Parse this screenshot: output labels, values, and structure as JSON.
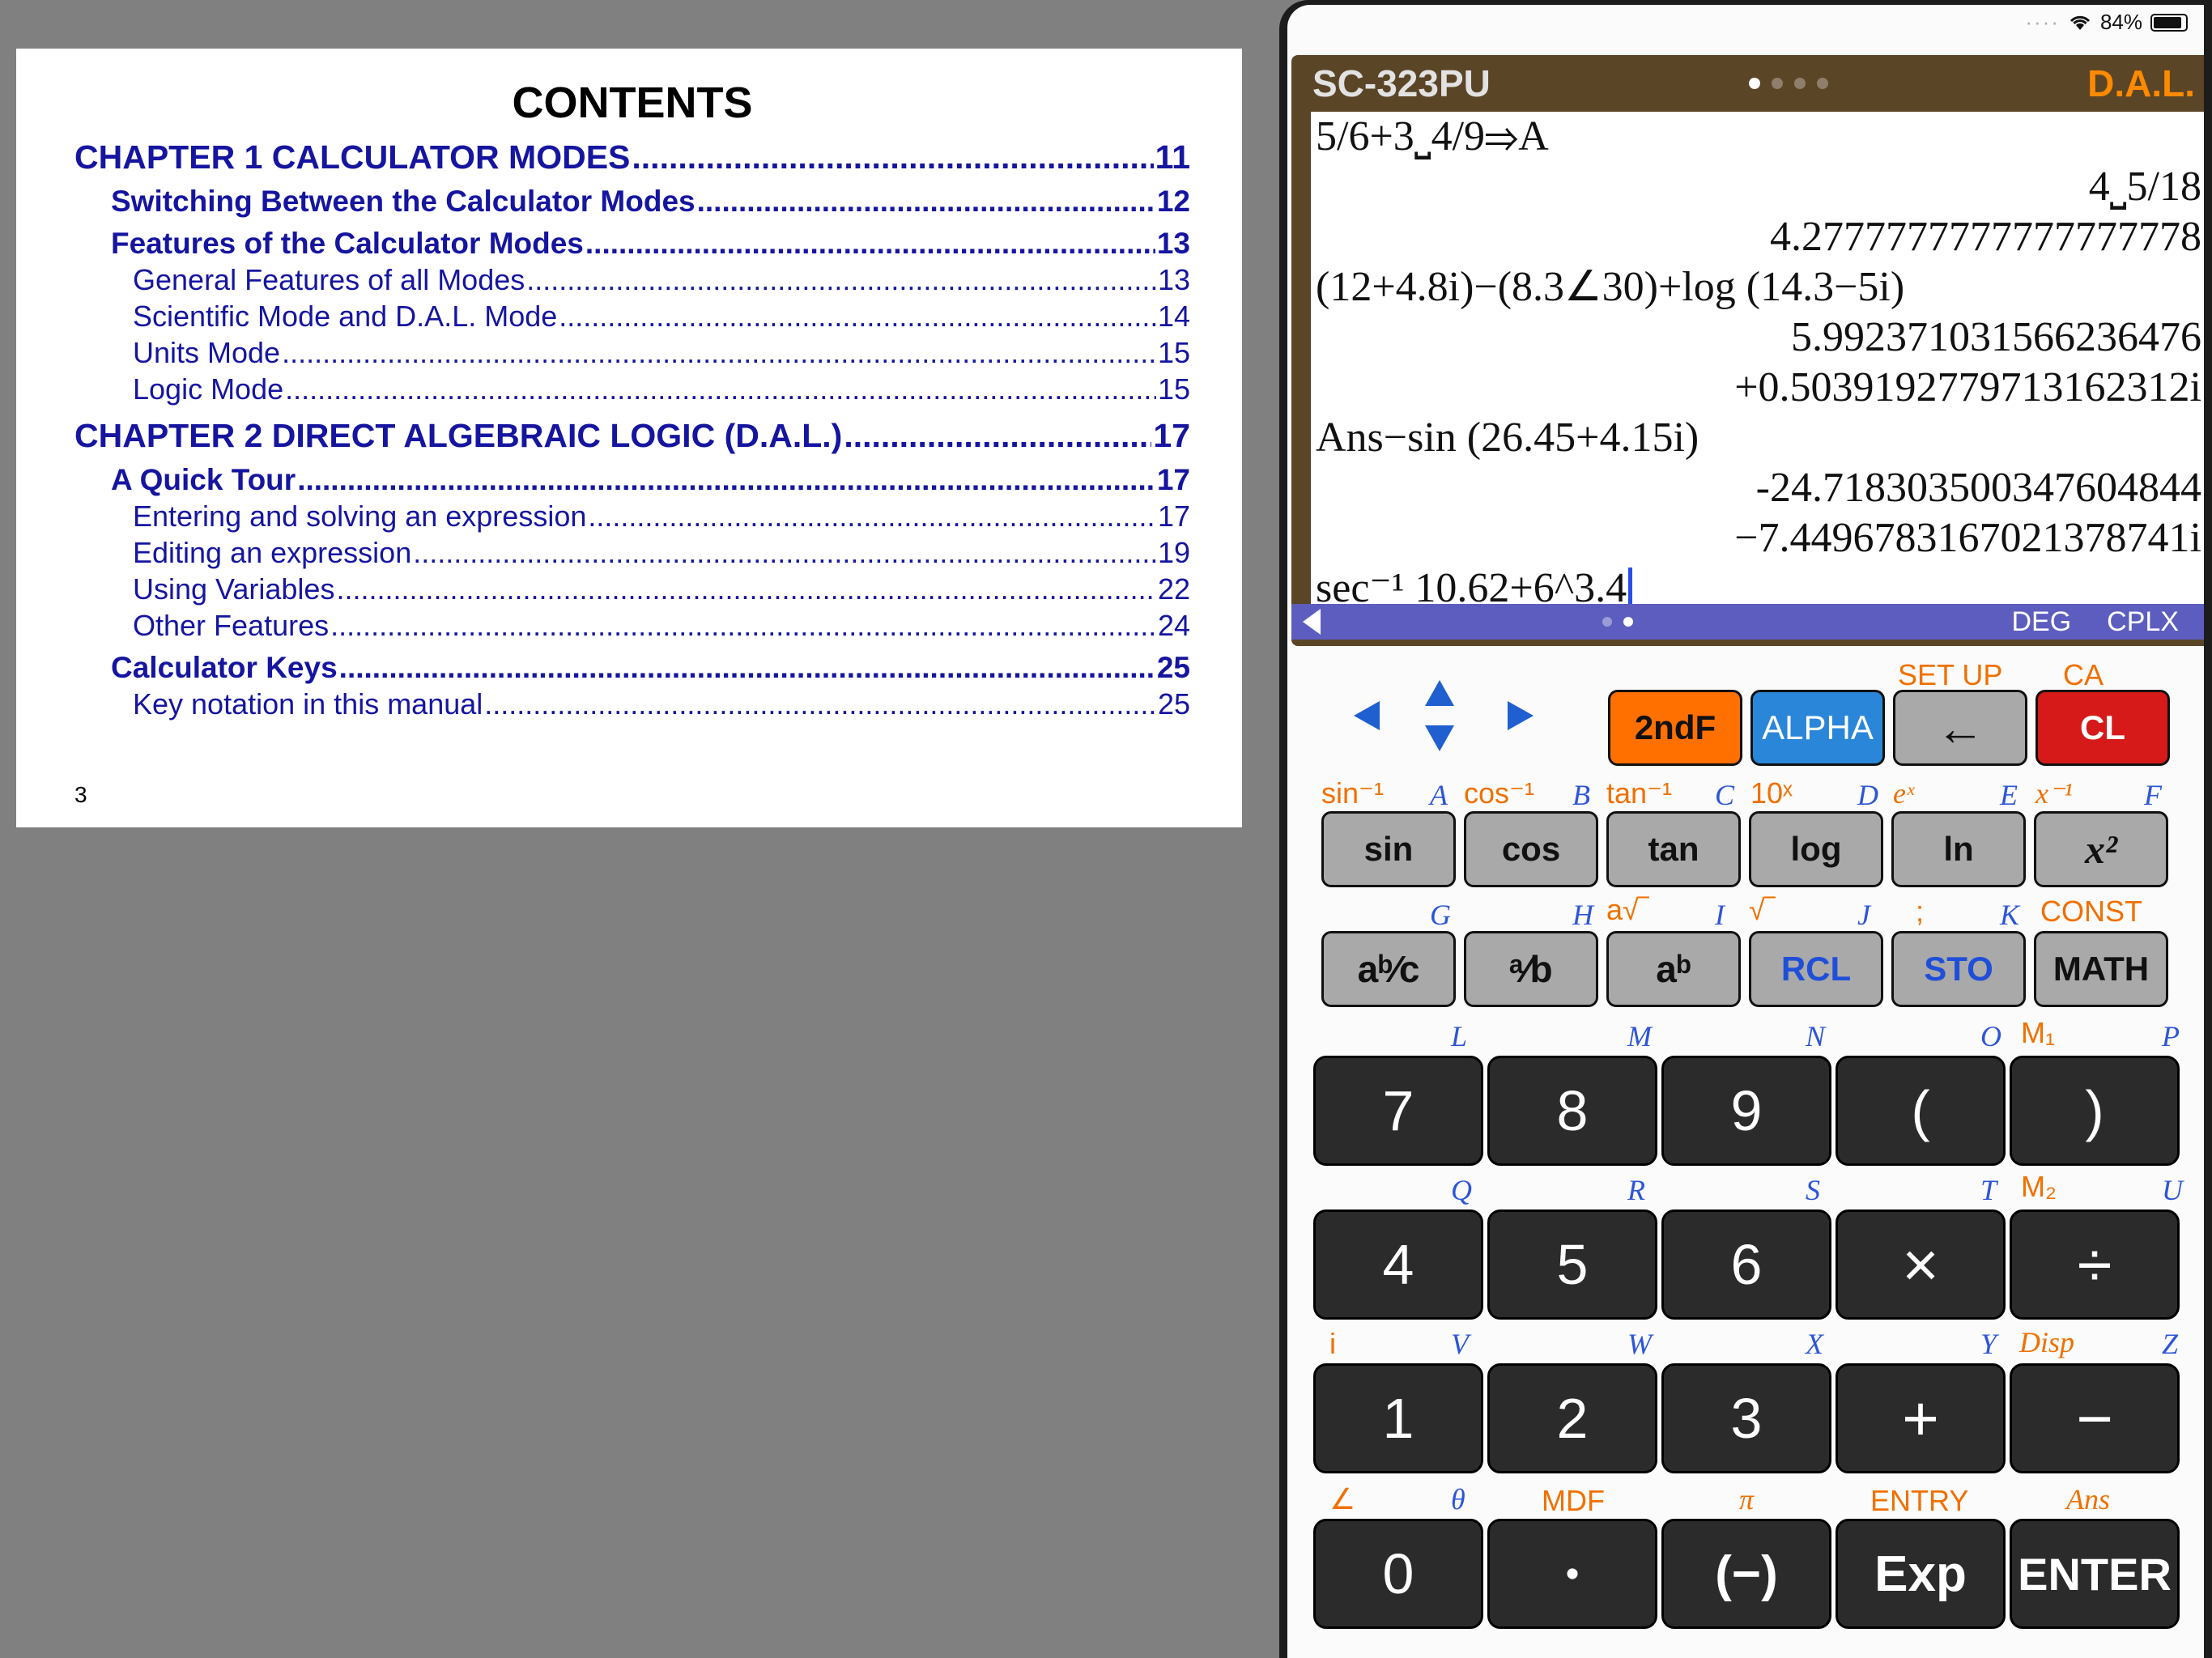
{
  "manual": {
    "title": "CONTENTS",
    "page_number": "3",
    "toc": [
      {
        "level": 0,
        "title": "CHAPTER 1 CALCULATOR MODES",
        "page": "11"
      },
      {
        "level": 1,
        "title": "Switching Between the Calculator Modes",
        "page": "12"
      },
      {
        "level": 1,
        "title": "Features of the Calculator Modes",
        "page": "13"
      },
      {
        "level": 2,
        "title": "General Features of all Modes",
        "page": "13"
      },
      {
        "level": 2,
        "title": "Scientific Mode and D.A.L. Mode",
        "page": "14"
      },
      {
        "level": 2,
        "title": "Units Mode",
        "page": "15"
      },
      {
        "level": 2,
        "title": "Logic Mode",
        "page": "15"
      },
      {
        "level": 0,
        "title": "CHAPTER 2 DIRECT ALGEBRAIC LOGIC (D.A.L.)",
        "page": "17"
      },
      {
        "level": 1,
        "title": "A Quick Tour",
        "page": "17"
      },
      {
        "level": 2,
        "title": "Entering and solving an expression",
        "page": "17"
      },
      {
        "level": 2,
        "title": "Editing an expression",
        "page": "19"
      },
      {
        "level": 2,
        "title": "Using Variables",
        "page": "22"
      },
      {
        "level": 2,
        "title": "Other Features",
        "page": "24"
      },
      {
        "level": 1,
        "title": "Calculator Keys",
        "page": "25"
      },
      {
        "level": 2,
        "title": "Key notation in this manual",
        "page": "25"
      }
    ]
  },
  "status": {
    "battery": "84%"
  },
  "calculator": {
    "model": "SC-323PU",
    "mode_badge": "D.A.L.",
    "indicators": [
      "DEG",
      "CPLX"
    ],
    "display_lines": [
      {
        "text": "5/6+3⎵4/9⇒A",
        "align": "left"
      },
      {
        "text": "4⎵5/18",
        "align": "right"
      },
      {
        "text": "4.2777777777777777778",
        "align": "right"
      },
      {
        "text": "(12+4.8i)−(8.3∠30)+log (14.3−5i)",
        "align": "left"
      },
      {
        "text": "5.99237103156623647​6",
        "align": "right"
      },
      {
        "text": "+0.5039192779713162312i",
        "align": "right"
      },
      {
        "text": "Ans−sin (26.45+4.15i)",
        "align": "left"
      },
      {
        "text": "-24.718303500347604844",
        "align": "right"
      },
      {
        "text": "−7.4496783167021378741i",
        "align": "right"
      },
      {
        "text": "sec⁻¹ 10.62+6^3.4",
        "align": "left"
      }
    ],
    "keys": {
      "second_f": "2ndF",
      "alpha": "ALPHA",
      "backspace": "←",
      "clear": "CL",
      "sin": "sin",
      "cos": "cos",
      "tan": "tan",
      "log": "log",
      "ln": "ln",
      "x_squared": "x²",
      "mixed_fraction": "aᵇ⁄c",
      "fraction": "ᵃ⁄b",
      "power": "aᵇ",
      "rcl": "RCL",
      "sto": "STO",
      "math": "MATH",
      "seven": "7",
      "eight": "8",
      "nine": "9",
      "open_paren": "(",
      "close_paren": ")",
      "four": "4",
      "five": "5",
      "six": "6",
      "multiply": "×",
      "divide": "÷",
      "one": "1",
      "two": "2",
      "three": "3",
      "plus": "+",
      "minus": "−",
      "zero": "0",
      "decimal": "•",
      "negate": "(−)",
      "exp": "Exp",
      "enter": "ENTER"
    },
    "labels": {
      "setup": "SET UP",
      "ca": "CA",
      "asin": "sin⁻¹",
      "acos": "cos⁻¹",
      "atan": "tan⁻¹",
      "ten_x": "10ˣ",
      "e_x": "eˣ",
      "inverse": "x⁻¹",
      "root_n": "a√‾",
      "sqrt": "√‾",
      "semicolon": ";",
      "const": "CONST",
      "m1": "M₁",
      "m2": "M₂",
      "imag": "i",
      "disp": "Disp",
      "angle": "∠",
      "theta": "θ",
      "mdf": "MDF",
      "pi": "π",
      "entry": "ENTRY",
      "ans": "Ans",
      "alpha_letters": {
        "A": "A",
        "B": "B",
        "C": "C",
        "D": "D",
        "E": "E",
        "F": "F",
        "G": "G",
        "H": "H",
        "I": "I",
        "J": "J",
        "K": "K",
        "L": "L",
        "M": "M",
        "N": "N",
        "O": "O",
        "P": "P",
        "Q": "Q",
        "R": "R",
        "S": "S",
        "T": "T",
        "U": "U",
        "V": "V",
        "W": "W",
        "X": "X",
        "Y": "Y",
        "Z": "Z"
      }
    },
    "colors": {
      "display_frame": "#5b4527",
      "mode_bar": "#5d5dbf",
      "second_f": "#ff7000",
      "alpha": "#2a86d8",
      "clear": "#d61a1a",
      "shift_label": "#f07000",
      "alpha_label": "#2d55d8"
    }
  }
}
